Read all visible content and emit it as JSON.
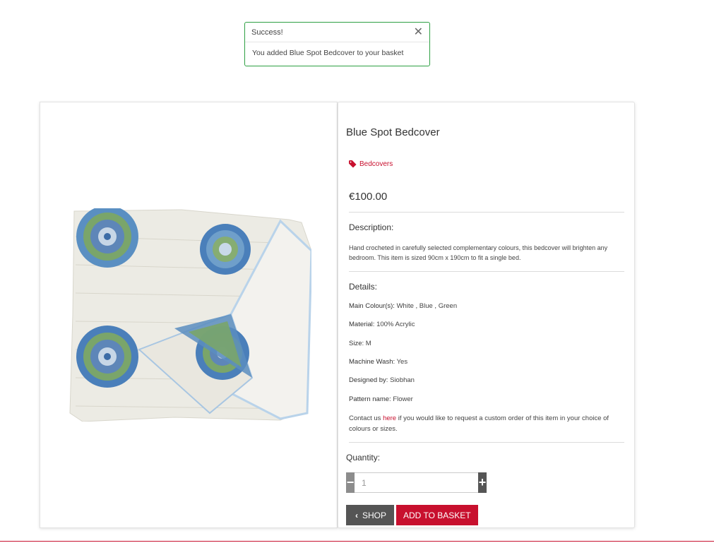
{
  "toast": {
    "title": "Success!",
    "message": "You added Blue Spot Bedcover to your basket",
    "border_color": "#2ea043"
  },
  "product": {
    "name": "Blue Spot Bedcover",
    "category": "Bedcovers",
    "price": "€100.00",
    "description_title": "Description:",
    "description": "Hand crocheted in carefully selected complementary colours, this bedcover will brighten any bedroom. This item is sized 90cm x 190cm to fit a single bed.",
    "details_title": "Details:",
    "details": [
      {
        "key": "Main Colour(s):",
        "value": "White , Blue , Green"
      },
      {
        "key": "Material:",
        "value": "100% Acrylic"
      },
      {
        "key": "Size:",
        "value": "M"
      },
      {
        "key": "Machine Wash:",
        "value": "Yes"
      },
      {
        "key": "Designed by:",
        "value": "Siobhan"
      },
      {
        "key": "Pattern name:",
        "value": "Flower"
      }
    ],
    "contact_prefix": "Contact us",
    "contact_link": "here",
    "contact_suffix": "if you would like to request a custom order of this item in your choice of colours or sizes."
  },
  "quantity": {
    "label": "Quantity:",
    "value": "1",
    "minus_icon": "minus-icon",
    "plus_icon": "plus-icon"
  },
  "buttons": {
    "shop_label": "SHOP",
    "add_label": "ADD TO BASKET"
  },
  "colors": {
    "accent": "#c8102e",
    "button_dark": "#555555"
  }
}
